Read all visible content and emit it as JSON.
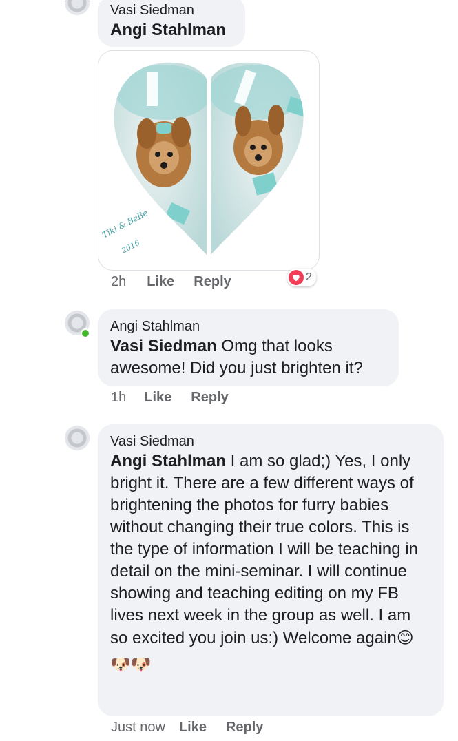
{
  "comments": [
    {
      "author": "Vasi Siedman",
      "mention": "Angi Stahlman",
      "text": "",
      "photo_caption_line1": "Tiki & BeBe",
      "photo_caption_line2": "2016",
      "time": "2h",
      "like_label": "Like",
      "reply_label": "Reply",
      "reaction_count": "2"
    },
    {
      "author": "Angi Stahlman",
      "mention": "Vasi Siedman",
      "text": " Omg that looks awesome! Did you just brighten it?",
      "time": "1h",
      "like_label": "Like",
      "reply_label": "Reply"
    },
    {
      "author": "Vasi Siedman",
      "mention": "Angi Stahlman",
      "text": " I am so glad;) Yes, I only bright it. There are a few different ways of brightening the photos for furry babies without changing their true colors. This is the type of information I will be teaching in detail on the mini-seminar. I will continue showing and teaching editing on my FB lives next week in the group as well. I am so excited you join us:) Welcome again",
      "emoji_trailing": "😊",
      "emoji_line": "🐶🐶",
      "time": "Just now",
      "like_label": "Like",
      "reply_label": "Reply"
    }
  ],
  "colors": {
    "bubble": "#f0f2f5",
    "meta_text": "#65676b",
    "online": "#42b72a",
    "love": "#f33e58"
  },
  "icons": [
    "avatar-placeholder-icon",
    "online-status-icon",
    "love-reaction-icon"
  ]
}
